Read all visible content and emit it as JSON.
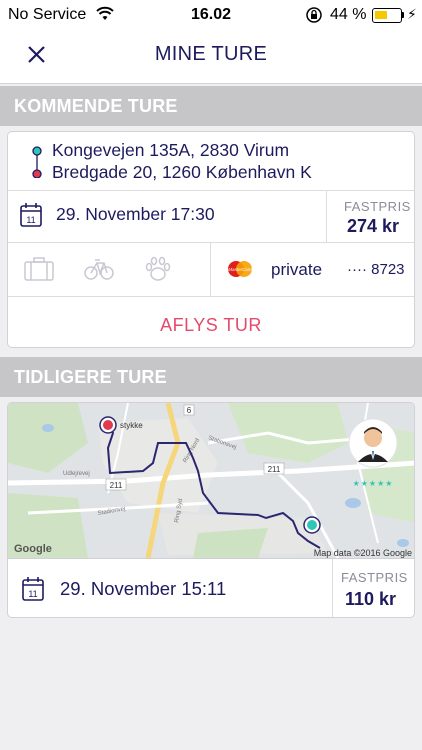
{
  "status": {
    "carrier": "No Service",
    "time": "16.02",
    "battery": "44 %"
  },
  "header": {
    "title": "MINE TURE"
  },
  "upcoming": {
    "section_title": "KOMMENDE TURE",
    "from": "Kongevejen 135A, 2830 Virum",
    "to": "Bredgade 20, 1260 København K",
    "date_icon_day": "11",
    "datetime": "29. November 17:30",
    "price_label": "FASTPRIS",
    "price": "274 kr",
    "payment_brand": "MasterCard",
    "payment_name": "private",
    "card_digits": "···· 8723",
    "cancel_label": "AFLYS TUR"
  },
  "past": {
    "section_title": "TIDLIGERE TURE",
    "map_place": "stykke",
    "map_road_1": "211",
    "map_road_2": "211",
    "map_road_3": "Ring Nord",
    "map_road_4": "Ring Syd",
    "map_road_5": "Stationsvej",
    "map_road_6": "Udlejrevej",
    "map_road_7": "Stadionvej",
    "map_road_8": "6",
    "google_label": "Google",
    "map_attribution": "Map data ©2016 Google",
    "rating_stars": 5,
    "date_icon_day": "11",
    "datetime": "29. November 15:11",
    "price_label": "FASTPRIS",
    "price": "110 kr"
  },
  "colors": {
    "brand": "#1d1b5e",
    "cancel": "#e64a6a",
    "section_bg": "#c6c6c9",
    "teal": "#31c4b8",
    "red_pin": "#e03a4e"
  },
  "icons": [
    "close-icon",
    "wifi-icon",
    "rotation-lock-icon",
    "battery-icon",
    "calendar-icon",
    "luggage-icon",
    "bicycle-icon",
    "paw-icon",
    "mastercard-icon",
    "route-icon",
    "driver-avatar",
    "star-icon"
  ]
}
